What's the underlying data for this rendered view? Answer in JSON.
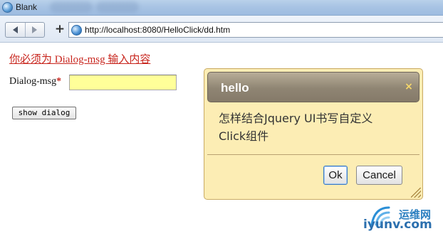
{
  "window": {
    "title": "Blank"
  },
  "toolbar": {
    "back_icon": "back-arrow-icon",
    "forward_icon": "forward-arrow-icon",
    "new_tab_label": "+",
    "url": "http://localhost:8080/HelloClick/dd.htm"
  },
  "page": {
    "error_message": "你必须为 Dialog-msg 输入内容",
    "field_label": "Dialog-msg",
    "required_mark": "*",
    "field_value": "",
    "show_button": "show dialog"
  },
  "dialog": {
    "title": "hello",
    "close_glyph": "×",
    "body_line1": "怎样结合Jquery UI书写自定义",
    "body_line2": "Click组件",
    "ok_label": "Ok",
    "cancel_label": "Cancel"
  },
  "watermark": {
    "cn": "运维网",
    "en": "iyunv.com"
  },
  "colors": {
    "error_red": "#c8261e",
    "input_highlight": "#ffff99",
    "dialog_bg": "#fcedb4",
    "dialog_header": "#8f8573",
    "close_icon": "#f7d86a"
  }
}
